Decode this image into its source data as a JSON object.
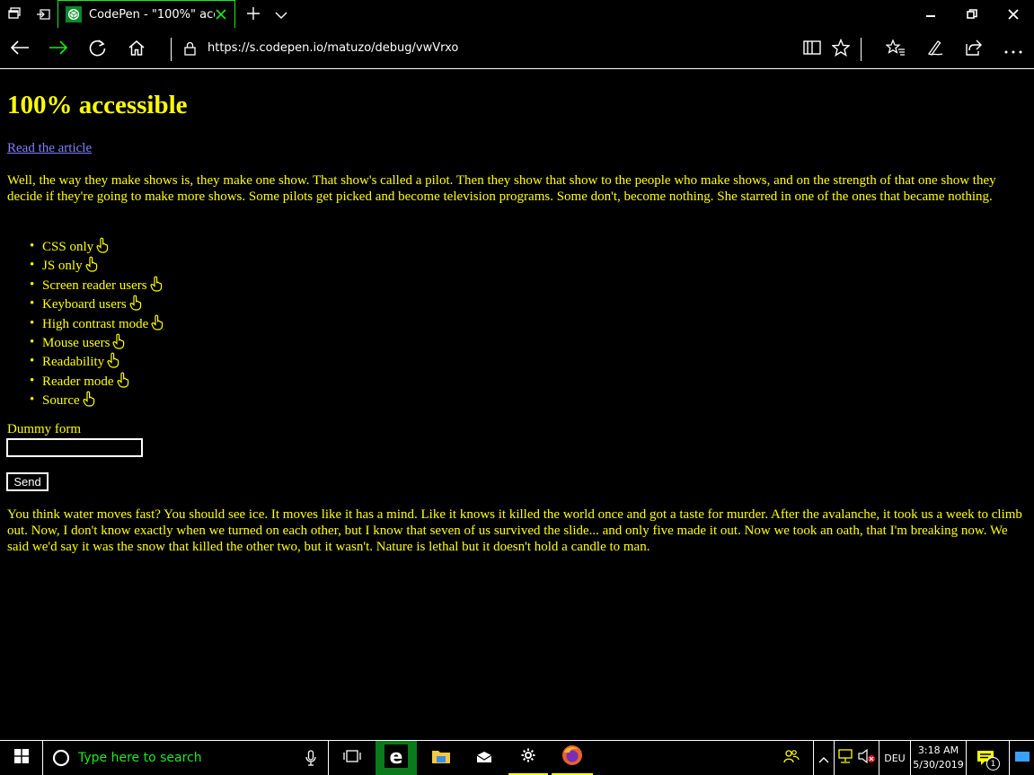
{
  "browser": {
    "tab_title": "CodePen - \"100%\" acce:",
    "url": "https://s.codepen.io/matuzo/debug/vwVrxo"
  },
  "page": {
    "heading": "100% accessible",
    "article_link": "Read the article",
    "para1": "Well, the way they make shows is, they make one show. That show's called a pilot. Then they show that show to the people who make shows, and on the strength of that one show they decide if they're going to make more shows. Some pilots get picked and become television programs. Some don't, become nothing. She starred in one of the ones that became nothing.",
    "features": [
      "CSS only",
      "JS only",
      "Screen reader users",
      "Keyboard users",
      "High contrast mode",
      "Mouse users",
      "Readability",
      "Reader mode",
      "Source"
    ],
    "form_label": "Dummy form",
    "send_label": "Send",
    "para2": "You think water moves fast? You should see ice. It moves like it has a mind. Like it knows it killed the world once and got a taste for murder. After the avalanche, it took us a week to climb out. Now, I don't know exactly when we turned on each other, but I know that seven of us survived the slide... and only five made it out. Now we took an oath, that I'm breaking now. We said we'd say it was the snow that killed the other two, but it wasn't. Nature is lethal but it doesn't hold a candle to man."
  },
  "taskbar": {
    "search_placeholder": "Type here to search",
    "language": "DEU",
    "time": "3:18 AM",
    "date": "5/30/2019",
    "notification_count": "1"
  },
  "colors": {
    "text": "#ffff00",
    "link": "#8080ff",
    "accent": "#1aeb1a",
    "background": "#000000"
  }
}
